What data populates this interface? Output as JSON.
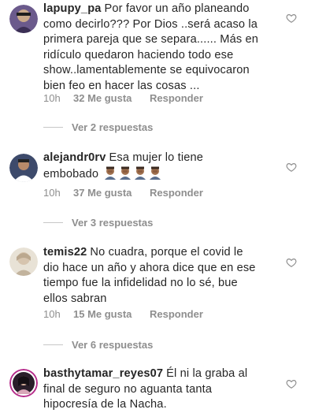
{
  "comments": [
    {
      "username": "lapupy_pa",
      "lines": [
        "Por favor un año planeando",
        "como decirlo??? Por Dios ..será acaso la",
        "primera pareja que se separa...... Más en",
        "ridículo quedaron haciendo todo ese",
        "show..lamentablemente se equivocaron",
        "bien feo en hacer las cosas ..."
      ],
      "time": "10h",
      "likes": "32 Me gusta",
      "reply_label": "Responder",
      "view_replies": "Ver 2 respuestas",
      "avatar_color": "#6b5a8c"
    },
    {
      "username": "alejandr0rv",
      "lines": [
        "Esa mujer lo tiene",
        "embobado"
      ],
      "emoji_count": 4,
      "emoji_icon": "man-facepalming-emoji",
      "time": "10h",
      "likes": "37 Me gusta",
      "reply_label": "Responder",
      "view_replies": "Ver 3 respuestas",
      "avatar_color": "#3d4a6b"
    },
    {
      "username": "temis22",
      "lines": [
        "No cuadra, porque el covid le",
        "dio hace un año y ahora dice que en ese",
        "tiempo fue la infidelidad no lo sé, bue",
        "ellos sabran"
      ],
      "time": "10h",
      "likes": "15 Me gusta",
      "reply_label": "Responder",
      "view_replies": "Ver 6 respuestas",
      "avatar_color": "#d8d0c2"
    },
    {
      "username": "basthytamar_reyes07",
      "lines": [
        "Él ni la graba al",
        "final de seguro no aguanta tanta",
        "hipocresía de la Nacha."
      ],
      "avatar_color": "#2a1f2a"
    }
  ],
  "colors": {
    "text": "#262626",
    "secondary": "#8e8e8e",
    "divider": "#c7c7c7"
  }
}
